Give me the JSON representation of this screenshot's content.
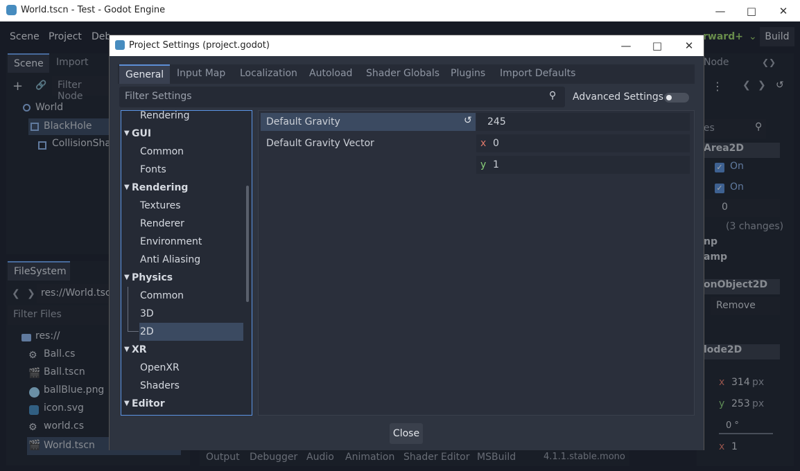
{
  "window": {
    "title": "World.tscn - Test - Godot Engine",
    "icon": "godot-icon"
  },
  "menu": {
    "scene": "Scene",
    "project": "Project",
    "debug": "Deb",
    "renderer": "rward+",
    "build": "Build"
  },
  "left_dock": {
    "tab_scene": "Scene",
    "tab_import": "Import",
    "filter_placeholder": "Filter Node",
    "tree": [
      {
        "label": "World"
      },
      {
        "label": "BlackHole"
      },
      {
        "label": "CollisionShap"
      }
    ],
    "filesystem_tab": "FileSystem",
    "path": "res://World.tsc",
    "filter_files": "Filter Files",
    "files": [
      {
        "label": "res://"
      },
      {
        "label": "Ball.cs"
      },
      {
        "label": "Ball.tscn"
      },
      {
        "label": "ballBlue.png"
      },
      {
        "label": "icon.svg"
      },
      {
        "label": "world.cs"
      },
      {
        "label": "World.tscn"
      }
    ]
  },
  "bottom_tabs": {
    "output": "Output",
    "debugger": "Debugger",
    "audio": "Audio",
    "animation": "Animation",
    "shader_editor": "Shader Editor",
    "msbuild": "MSBuild",
    "version": "4.1.1.stable.mono"
  },
  "inspector": {
    "node_tab": "Node",
    "search_placeholder": "ies",
    "area2d": "Area2D",
    "on1": "On",
    "on2": "On",
    "spin": "0",
    "changes": "(3 changes)",
    "mp": "np",
    "amp": "amp",
    "collision_obj": "onObject2D",
    "remove": "Remove",
    "node2d": "lode2D",
    "pos_x": "314",
    "pos_y": "253",
    "px": "px",
    "rot": "0 °",
    "scale_x": "1",
    "x_label": "x",
    "y_label": "y"
  },
  "dialog": {
    "title": "Project Settings (project.godot)",
    "tabs": [
      "General",
      "Input Map",
      "Localization",
      "Autoload",
      "Shader Globals",
      "Plugins",
      "Import Defaults"
    ],
    "filter_placeholder": "Filter Settings",
    "advanced": "Advanced Settings",
    "tree": [
      {
        "label": "Rendering",
        "cat": false
      },
      {
        "label": "GUI",
        "cat": true
      },
      {
        "label": "Common",
        "cat": false
      },
      {
        "label": "Fonts",
        "cat": false
      },
      {
        "label": "Rendering",
        "cat": true
      },
      {
        "label": "Textures",
        "cat": false
      },
      {
        "label": "Renderer",
        "cat": false
      },
      {
        "label": "Environment",
        "cat": false
      },
      {
        "label": "Anti Aliasing",
        "cat": false
      },
      {
        "label": "Physics",
        "cat": true
      },
      {
        "label": "Common",
        "cat": false
      },
      {
        "label": "3D",
        "cat": false
      },
      {
        "label": "2D",
        "cat": false,
        "selected": true
      },
      {
        "label": "XR",
        "cat": true
      },
      {
        "label": "OpenXR",
        "cat": false
      },
      {
        "label": "Shaders",
        "cat": false
      },
      {
        "label": "Editor",
        "cat": true
      }
    ],
    "props": {
      "gravity_label": "Default Gravity",
      "gravity_value": "245",
      "vector_label": "Default Gravity Vector",
      "vx_label": "x",
      "vx": "0",
      "vy_label": "y",
      "vy": "1"
    },
    "close": "Close"
  }
}
